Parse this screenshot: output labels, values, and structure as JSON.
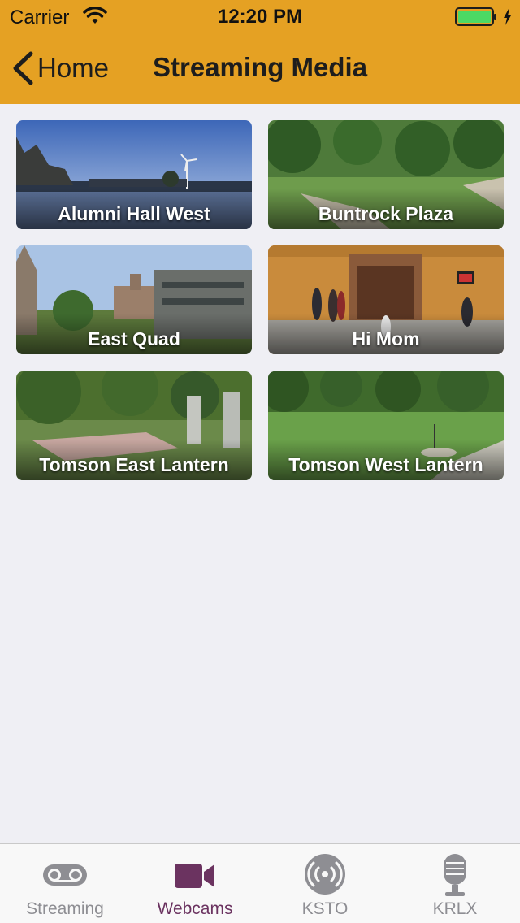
{
  "status_bar": {
    "carrier": "Carrier",
    "time": "12:20 PM",
    "battery_level": 1.0,
    "battery_color": "#4cd964"
  },
  "nav": {
    "back_label": "Home",
    "title": "Streaming Media",
    "bar_color": "#e5a123"
  },
  "webcams": [
    {
      "label": "Alumni Hall West",
      "scene": "sky-lake-wind-turbine"
    },
    {
      "label": "Buntrock Plaza",
      "scene": "trees-lawn-path"
    },
    {
      "label": "East Quad",
      "scene": "buildings-quad"
    },
    {
      "label": "Hi Mom",
      "scene": "indoor-wood-wall"
    },
    {
      "label": "Tomson East Lantern",
      "scene": "trees-shade-path"
    },
    {
      "label": "Tomson West Lantern",
      "scene": "lawn-trees"
    }
  ],
  "tabs": [
    {
      "label": "Streaming",
      "icon": "tape-icon",
      "active": false
    },
    {
      "label": "Webcams",
      "icon": "video-camera-icon",
      "active": true
    },
    {
      "label": "KSTO",
      "icon": "radio-waves-icon",
      "active": false
    },
    {
      "label": "KRLX",
      "icon": "microphone-icon",
      "active": false
    }
  ],
  "colors": {
    "accent": "#6b3360",
    "inactive_tab": "#8e8e93",
    "background": "#efeff4"
  }
}
